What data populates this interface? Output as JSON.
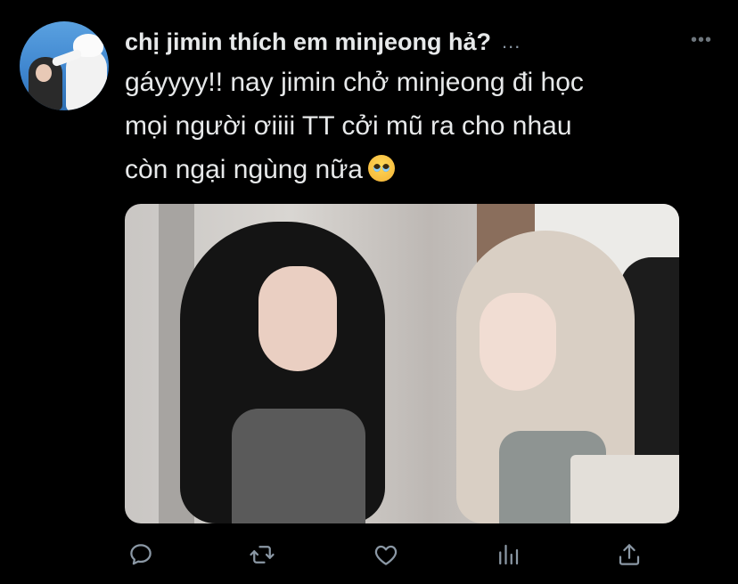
{
  "tweet": {
    "display_name": "chị jimin thích em minjeong hả?",
    "name_truncation": "...",
    "more_menu_glyph": "•••",
    "text_lines": [
      "gáyyyy!! nay jimin chở minjeong đi học",
      "mọi người ơiiii TT cởi mũ ra cho nhau",
      "còn ngại ngùng nữa"
    ],
    "emoji": "pleading-face-emoji"
  },
  "media": {
    "type": "photo"
  },
  "actions": [
    {
      "name": "reply",
      "icon": "speech-bubble-icon"
    },
    {
      "name": "retweet",
      "icon": "retweet-arrows-icon"
    },
    {
      "name": "like",
      "icon": "heart-icon"
    },
    {
      "name": "analytics",
      "icon": "bar-chart-icon"
    },
    {
      "name": "share",
      "icon": "share-upload-icon"
    }
  ],
  "colors": {
    "background": "#000000",
    "text": "#e7e9ea",
    "icon": "#8b98a5"
  }
}
